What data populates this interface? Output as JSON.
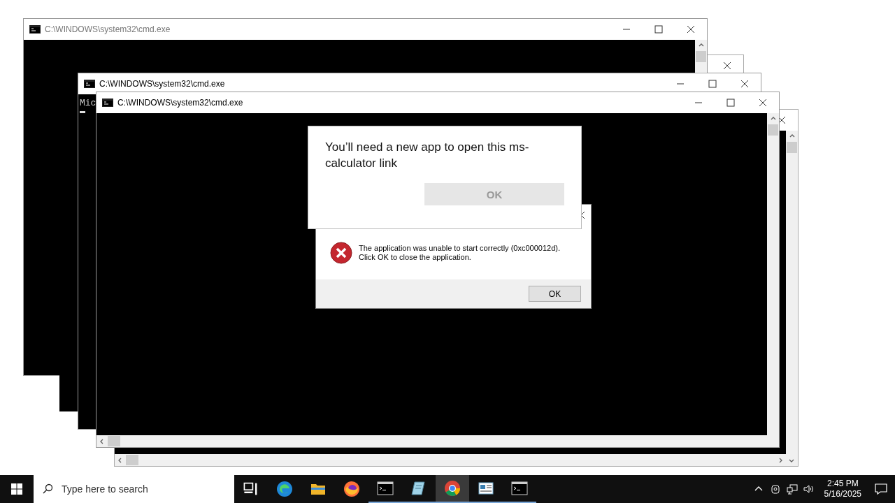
{
  "windows": [
    {
      "title": "C:\\WINDOWS\\system32\\cmd.exe",
      "focused": false
    },
    {
      "title": "C:\\WINDOWS\\system32\\cmd.exe",
      "focused": true,
      "console_lines": [
        "Mic"
      ]
    },
    {
      "title": "C:\\WINDOWS\\system32\\cmd.exe",
      "focused": true
    }
  ],
  "error_dialog": {
    "message": "The application was unable to start correctly (0xc000012d). Click OK to close the application.",
    "button": "OK"
  },
  "app_prompt": {
    "message": "You’ll need a new app to open this ms-calculator link",
    "button": {
      "label": "OK",
      "disabled": true
    }
  },
  "taskbar": {
    "search_placeholder": "Type here to search",
    "apps": [
      {
        "kind": "taskview",
        "running": false,
        "selected": false
      },
      {
        "kind": "edge",
        "running": false,
        "selected": false
      },
      {
        "kind": "explorer",
        "running": false,
        "selected": false
      },
      {
        "kind": "firefox",
        "running": false,
        "selected": false
      },
      {
        "kind": "console",
        "running": true,
        "selected": false
      },
      {
        "kind": "notepad",
        "running": true,
        "selected": false
      },
      {
        "kind": "chrome",
        "running": true,
        "selected": true
      },
      {
        "kind": "document",
        "running": true,
        "selected": false
      },
      {
        "kind": "console",
        "running": true,
        "selected": false
      }
    ],
    "time": "2:45 PM",
    "date": "5/16/2025"
  }
}
